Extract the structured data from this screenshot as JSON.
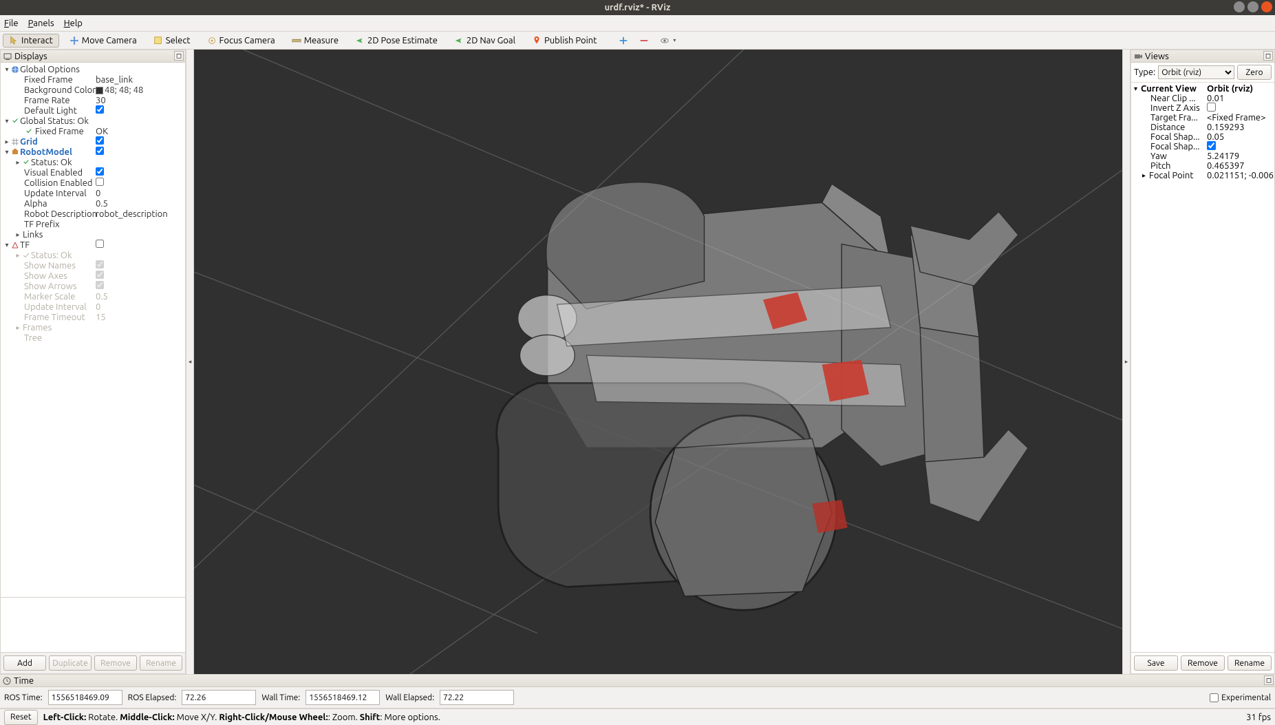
{
  "window": {
    "title": "urdf.rviz* - RViz"
  },
  "menu": {
    "file": "File",
    "panels": "Panels",
    "help": "Help"
  },
  "toolbar": {
    "interact": "Interact",
    "move_camera": "Move Camera",
    "select": "Select",
    "focus_camera": "Focus Camera",
    "measure": "Measure",
    "pose_estimate": "2D Pose Estimate",
    "nav_goal": "2D Nav Goal",
    "publish_point": "Publish Point"
  },
  "displays_panel": {
    "title": "Displays",
    "global_options": "Global Options",
    "fixed_frame": {
      "label": "Fixed Frame",
      "value": "base_link"
    },
    "background_color": {
      "label": "Background Color",
      "value": "48; 48; 48"
    },
    "frame_rate": {
      "label": "Frame Rate",
      "value": "30"
    },
    "default_light": {
      "label": "Default Light",
      "checked": true
    },
    "global_status": "Global Status: Ok",
    "fixed_frame_status": {
      "label": "Fixed Frame",
      "value": "OK"
    },
    "grid": {
      "label": "Grid",
      "checked": true
    },
    "robot_model": {
      "label": "RobotModel",
      "checked": true
    },
    "status_ok": "Status: Ok",
    "visual_enabled": {
      "label": "Visual Enabled",
      "checked": true
    },
    "collision_enabled": {
      "label": "Collision Enabled",
      "checked": false
    },
    "update_interval": {
      "label": "Update Interval",
      "value": "0"
    },
    "alpha": {
      "label": "Alpha",
      "value": "0.5"
    },
    "robot_description": {
      "label": "Robot Description",
      "value": "robot_description"
    },
    "tf_prefix": {
      "label": "TF Prefix",
      "value": ""
    },
    "links": "Links",
    "tf": {
      "label": "TF",
      "checked": false
    },
    "tf_status": "Status: Ok",
    "show_names": {
      "label": "Show Names",
      "checked": true
    },
    "show_axes": {
      "label": "Show Axes",
      "checked": true
    },
    "show_arrows": {
      "label": "Show Arrows",
      "checked": true
    },
    "marker_scale": {
      "label": "Marker Scale",
      "value": "0.5"
    },
    "tf_update_interval": {
      "label": "Update Interval",
      "value": "0"
    },
    "frame_timeout": {
      "label": "Frame Timeout",
      "value": "15"
    },
    "frames": "Frames",
    "tree": "Tree",
    "buttons": {
      "add": "Add",
      "duplicate": "Duplicate",
      "remove": "Remove",
      "rename": "Rename"
    }
  },
  "views_panel": {
    "title": "Views",
    "type_label": "Type:",
    "type_value": "Orbit (rviz)",
    "zero": "Zero",
    "current_view": {
      "label": "Current View",
      "value": "Orbit (rviz)"
    },
    "near_clip": {
      "label": "Near Clip ...",
      "value": "0.01"
    },
    "invert_z": {
      "label": "Invert Z Axis",
      "checked": false
    },
    "target_frame": {
      "label": "Target Fra...",
      "value": "<Fixed Frame>"
    },
    "distance": {
      "label": "Distance",
      "value": "0.159293"
    },
    "focal_shape_size": {
      "label": "Focal Shap...",
      "value": "0.05"
    },
    "focal_shape_fixed": {
      "label": "Focal Shap...",
      "checked": true
    },
    "yaw": {
      "label": "Yaw",
      "value": "5.24179"
    },
    "pitch": {
      "label": "Pitch",
      "value": "0.465397"
    },
    "focal_point": {
      "label": "Focal Point",
      "value": "0.021151; -0.006..."
    },
    "buttons": {
      "save": "Save",
      "remove": "Remove",
      "rename": "Rename"
    }
  },
  "time_panel": {
    "title": "Time",
    "ros_time_label": "ROS Time:",
    "ros_time": "1556518469.09",
    "ros_elapsed_label": "ROS Elapsed:",
    "ros_elapsed": "72.26",
    "wall_time_label": "Wall Time:",
    "wall_time": "1556518469.12",
    "wall_elapsed_label": "Wall Elapsed:",
    "wall_elapsed": "72.22",
    "experimental": "Experimental"
  },
  "status": {
    "reset": "Reset",
    "hint_left": "Left-Click:",
    "hint_left_v": " Rotate. ",
    "hint_middle": "Middle-Click:",
    "hint_middle_v": " Move X/Y. ",
    "hint_right": "Right-Click/Mouse Wheel:",
    "hint_right_v": ": Zoom. ",
    "hint_shift": "Shift",
    "hint_shift_v": ": More options.",
    "fps": "31 fps"
  }
}
